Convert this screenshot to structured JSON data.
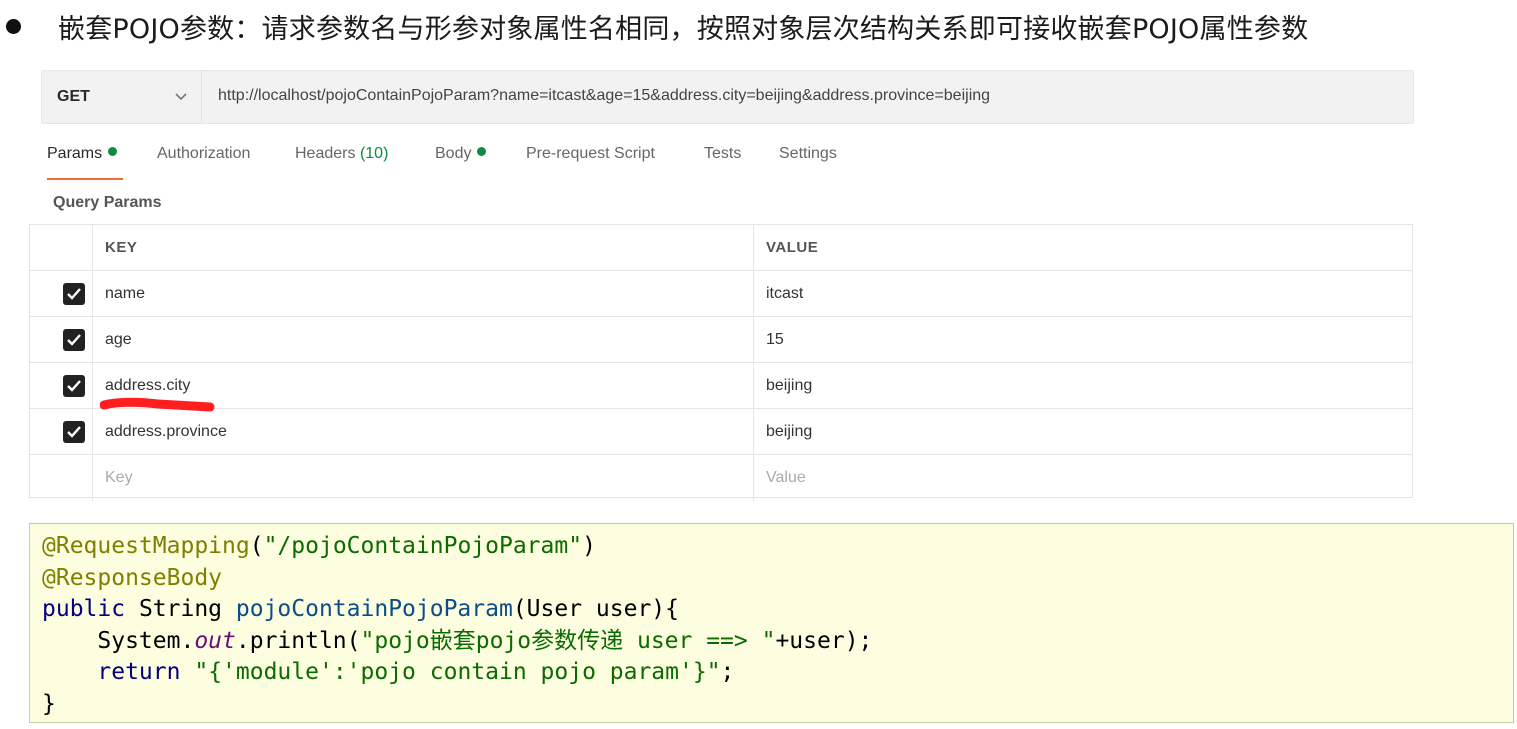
{
  "heading": {
    "text": "嵌套POJO参数：请求参数名与形参对象属性名相同，按照对象层次结构关系即可接收嵌套POJO属性参数"
  },
  "request": {
    "method": "GET",
    "url": "http://localhost/pojoContainPojoParam?name=itcast&age=15&address.city=beijing&address.province=beijing"
  },
  "tabs": [
    {
      "label": "Params",
      "dot": true
    },
    {
      "label": "Authorization"
    },
    {
      "label": "Headers",
      "count": "(10)"
    },
    {
      "label": "Body",
      "dot": true
    },
    {
      "label": "Pre-request Script"
    },
    {
      "label": "Tests"
    },
    {
      "label": "Settings"
    }
  ],
  "query_params": {
    "section_label": "Query Params",
    "headers": {
      "key": "KEY",
      "value": "VALUE"
    },
    "rows": [
      {
        "key": "name",
        "value": "itcast",
        "checked": true
      },
      {
        "key": "age",
        "value": "15",
        "checked": true
      },
      {
        "key": "address.city",
        "value": "beijing",
        "checked": true
      },
      {
        "key": "address.province",
        "value": "beijing",
        "checked": true
      }
    ],
    "placeholder": {
      "key": "Key",
      "value": "Value"
    }
  },
  "code": {
    "line1_ann": "@RequestMapping",
    "line1_open": "(",
    "line1_str": "\"/pojoContainPojoParam\"",
    "line1_close": ")",
    "line2_ann": "@ResponseBody",
    "line3_kw": "public",
    "line3_type": " String ",
    "line3_meth": "pojoContainPojoParam",
    "line3_rest": "(User user){",
    "line4_a": "    System.",
    "line4_field": "out",
    "line4_b": ".println(",
    "line4_str": "\"pojo嵌套pojo参数传递 user ==> \"",
    "line4_c": "+user);",
    "line5_kw": "    return",
    "line5_sp": " ",
    "line5_str": "\"{'module':'pojo contain pojo param'}\"",
    "line5_end": ";",
    "line6": "}"
  },
  "colors": {
    "accent_tab": "#f26b3a",
    "dot_green": "#0e8a43",
    "annotation": "#808000",
    "string": "#0a6b00",
    "keyword": "#000080"
  }
}
